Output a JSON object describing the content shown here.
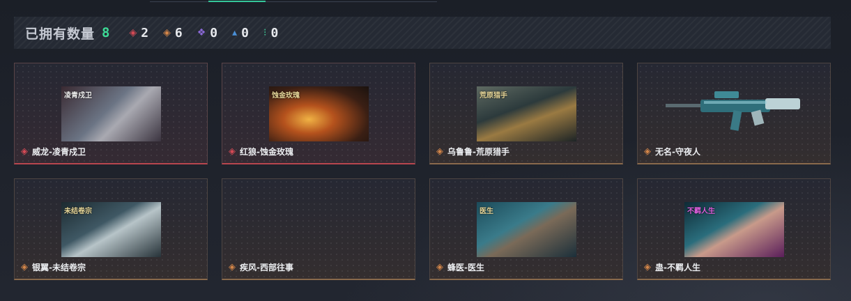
{
  "summary": {
    "label": "已拥有数量",
    "total": "8",
    "rarities": [
      {
        "icon": "red-diamond-icon",
        "glyph": "◈",
        "color": "#d64a55",
        "value": "2"
      },
      {
        "icon": "orange-diamond-icon",
        "glyph": "◈",
        "color": "#d48649",
        "value": "6"
      },
      {
        "icon": "purple-cluster-icon",
        "glyph": "❖",
        "color": "#8b6ad8",
        "value": "0"
      },
      {
        "icon": "blue-triangle-icon",
        "glyph": "▴",
        "color": "#4a8fd6",
        "value": "0"
      },
      {
        "icon": "green-arrows-icon",
        "glyph": "⁝",
        "color": "#3ecf9a",
        "value": "0"
      }
    ]
  },
  "cards": [
    {
      "name": "威龙-凌青戍卫",
      "rarity": "red",
      "thumb_caption": "凌青戍卫"
    },
    {
      "name": "红狼-蚀金玫瑰",
      "rarity": "red",
      "thumb_caption": "蚀金玫瑰"
    },
    {
      "name": "乌鲁鲁-荒原猎手",
      "rarity": "orange",
      "thumb_caption": "荒原猎手"
    },
    {
      "name": "无名-守夜人",
      "rarity": "orange",
      "thumb_caption": ""
    },
    {
      "name": "银翼-未结卷宗",
      "rarity": "orange",
      "thumb_caption": "未结卷宗"
    },
    {
      "name": "疾风-西部往事",
      "rarity": "orange",
      "thumb_caption": ""
    },
    {
      "name": "蜂医-医生",
      "rarity": "orange",
      "thumb_caption": "医生"
    },
    {
      "name": "蛊-不羁人生",
      "rarity": "orange",
      "thumb_caption": "不羁人生"
    }
  ]
}
